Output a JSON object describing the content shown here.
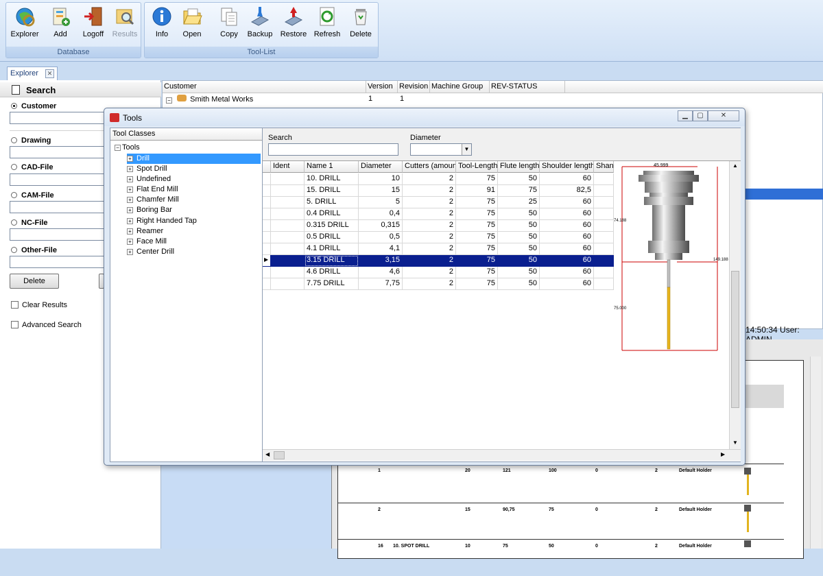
{
  "ribbon": {
    "database": {
      "caption": "Database",
      "buttons": [
        {
          "label": "Explorer",
          "icon": "explorer-icon",
          "enabled": true
        },
        {
          "label": "Add",
          "icon": "add-icon",
          "enabled": true
        },
        {
          "label": "Logoff",
          "icon": "logoff-icon",
          "enabled": true
        },
        {
          "label": "Results",
          "icon": "results-icon",
          "enabled": false
        }
      ]
    },
    "toollist": {
      "caption": "Tool-List",
      "buttons": [
        {
          "label": "Info",
          "icon": "info-icon"
        },
        {
          "label": "Open",
          "icon": "open-icon"
        },
        {
          "label": "Copy",
          "icon": "copy-icon"
        },
        {
          "label": "Backup",
          "icon": "backup-icon"
        },
        {
          "label": "Restore",
          "icon": "restore-icon"
        },
        {
          "label": "Refresh",
          "icon": "refresh-icon"
        },
        {
          "label": "Delete",
          "icon": "delete-icon"
        }
      ]
    }
  },
  "tab": {
    "label": "Explorer"
  },
  "search": {
    "title": "Search",
    "options": [
      "Customer",
      "Drawing",
      "CAD-File",
      "CAM-File",
      "NC-File",
      "Other-File"
    ],
    "selected": "Customer",
    "delete_label": "Delete",
    "clear_results": "Clear Results",
    "advanced": "Advanced Search"
  },
  "main_grid": {
    "headers": [
      "Customer",
      "Version",
      "Revision",
      "Machine Group",
      "REV-STATUS"
    ],
    "row": {
      "customer": "Smith Metal Works",
      "version": "1",
      "revision": "1"
    }
  },
  "status": {
    "text": "14:50:34 User: ADMIN"
  },
  "dialog": {
    "title": "Tools",
    "tool_classes_header": "Tool Classes",
    "tree_root": "Tools",
    "tree": [
      "Drill",
      "Spot Drill",
      "Undefined",
      "Flat End Mill",
      "Chamfer Mill",
      "Boring Bar",
      "Right Handed Tap",
      "Reamer",
      "Face Mill",
      "Center Drill"
    ],
    "tree_selected": "Drill",
    "search_label": "Search",
    "search_value": "",
    "diameter_label": "Diameter",
    "diameter_value": "",
    "columns": [
      "Ident",
      "Name 1",
      "Diameter",
      "Cutters (amount)",
      "Tool-Length",
      "Flute length",
      "Shoulder length",
      "Shank"
    ],
    "rows": [
      {
        "ident": "",
        "name": "10. DRILL",
        "diameter": "10",
        "cutters": "2",
        "length": "75",
        "flute": "50",
        "shoulder": "60"
      },
      {
        "ident": "",
        "name": "15. DRILL",
        "diameter": "15",
        "cutters": "2",
        "length": "91",
        "flute": "75",
        "shoulder": "82,5"
      },
      {
        "ident": "",
        "name": "5. DRILL",
        "diameter": "5",
        "cutters": "2",
        "length": "75",
        "flute": "25",
        "shoulder": "60"
      },
      {
        "ident": "",
        "name": "0.4 DRILL",
        "diameter": "0,4",
        "cutters": "2",
        "length": "75",
        "flute": "50",
        "shoulder": "60"
      },
      {
        "ident": "",
        "name": "0.315 DRILL",
        "diameter": "0,315",
        "cutters": "2",
        "length": "75",
        "flute": "50",
        "shoulder": "60"
      },
      {
        "ident": "",
        "name": "0.5 DRILL",
        "diameter": "0,5",
        "cutters": "2",
        "length": "75",
        "flute": "50",
        "shoulder": "60"
      },
      {
        "ident": "",
        "name": "4.1 DRILL",
        "diameter": "4,1",
        "cutters": "2",
        "length": "75",
        "flute": "50",
        "shoulder": "60"
      },
      {
        "ident": "",
        "name": "3.15 DRILL",
        "diameter": "3,15",
        "cutters": "2",
        "length": "75",
        "flute": "50",
        "shoulder": "60"
      },
      {
        "ident": "",
        "name": "4.6 DRILL",
        "diameter": "4,6",
        "cutters": "2",
        "length": "75",
        "flute": "50",
        "shoulder": "60"
      },
      {
        "ident": "",
        "name": "7.75 DRILL",
        "diameter": "7,75",
        "cutters": "2",
        "length": "75",
        "flute": "50",
        "shoulder": "60"
      }
    ],
    "selected_row": "3.15 DRILL",
    "preview": {
      "dim_top": "45.999",
      "dim_left": "74.188",
      "dim_right": "149.188",
      "dim_flute": "75.000"
    }
  },
  "report": {
    "rows": [
      {
        "pos": "1",
        "name": "",
        "d": "20",
        "l": "121",
        "f": "100",
        "z": "0",
        "n": "2",
        "holder": "Default Holder"
      },
      {
        "pos": "2",
        "name": "",
        "d": "15",
        "l": "90,75",
        "f": "75",
        "z": "0",
        "n": "2",
        "holder": "Default Holder"
      },
      {
        "pos": "16",
        "name": "10. SPOT DRILL",
        "d": "10",
        "l": "75",
        "f": "50",
        "z": "0",
        "n": "2",
        "holder": "Default Holder"
      }
    ]
  },
  "colors": {
    "selection": "#0a1f8f",
    "tree_selection": "#3399ff",
    "ribbon_caption": "#3b5b86"
  }
}
